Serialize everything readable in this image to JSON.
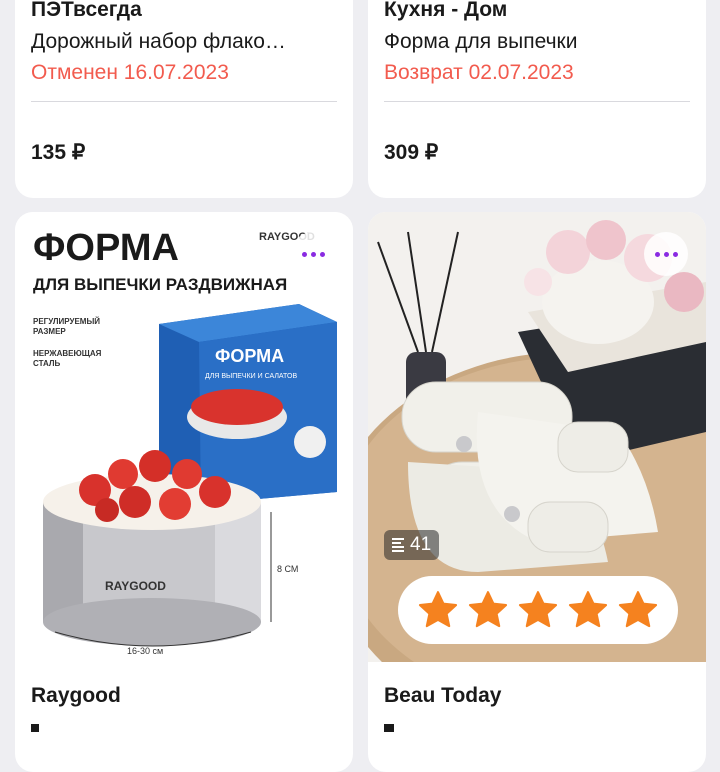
{
  "orders": [
    {
      "brand": "ПЭТвсегда",
      "title": "Дорожный набор флако…",
      "status": "Отменен 16.07.2023",
      "price": "135 ₽"
    },
    {
      "brand": "Кухня - Дом",
      "title": "Форма  для выпечки",
      "status": "Возврат 02.07.2023",
      "price": "309 ₽"
    }
  ],
  "products": [
    {
      "brand": "Raygood",
      "image": {
        "headline": "ФОРМА",
        "subheadline": "ДЛЯ ВЫПЕЧКИ РАЗДВИЖНАЯ",
        "feature1": "РЕГУЛИРУЕМЫЙ",
        "feature1b": "РАЗМЕР",
        "feature2": "НЕРЖАВЕЮЩАЯ",
        "feature2b": "СТАЛЬ",
        "logo": "RAYGOOD",
        "box_title": "ФОРМА",
        "box_sub": "ДЛЯ ВЫПЕЧКИ И САЛАТОВ",
        "height_label": "8 СМ",
        "size_label": "16-30 см"
      }
    },
    {
      "brand": "Beau Today",
      "review_count": "41",
      "rating": 5
    }
  ],
  "icons": {
    "more": "more-dots-icon",
    "reviews": "list-icon",
    "star": "star-icon"
  },
  "colors": {
    "status_red": "#f25b4e",
    "more_dots": "#8a2be2",
    "star": "#f5821f"
  }
}
